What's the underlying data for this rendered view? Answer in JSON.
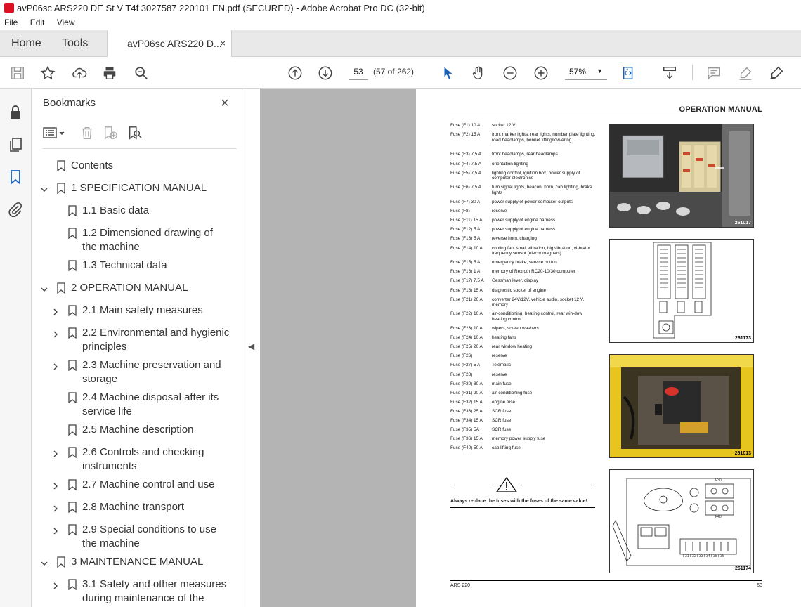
{
  "window": {
    "title": "avP06sc ARS220 DE St V T4f 3027587 220101 EN.pdf (SECURED) - Adobe Acrobat Pro DC (32-bit)"
  },
  "menu": [
    "File",
    "Edit",
    "View"
  ],
  "tabs": {
    "home": "Home",
    "tools": "Tools",
    "doc": "avP06sc ARS220 D...",
    "close": "×"
  },
  "toolbar": {
    "page_number": "53",
    "page_count": "(57 of 262)",
    "zoom": "57%"
  },
  "bookmarks": {
    "title": "Bookmarks",
    "close": "×",
    "items": [
      {
        "label": "Contents",
        "level": 0,
        "expand": "none"
      },
      {
        "label": "1 SPECIFICATION MANUAL",
        "level": 0,
        "expand": "open"
      },
      {
        "label": "1.1 Basic data",
        "level": 1,
        "expand": "none"
      },
      {
        "label": "1.2 Dimensioned drawing of",
        "label2": "the machine",
        "level": 1,
        "expand": "none"
      },
      {
        "label": "1.3 Technical data",
        "level": 1,
        "expand": "none"
      },
      {
        "label": "2 OPERATION MANUAL",
        "level": 0,
        "expand": "open"
      },
      {
        "label": "2.1 Main safety measures",
        "level": 1,
        "expand": "closed"
      },
      {
        "label": "2.2 Environmental and hygienic",
        "label2": "principles",
        "level": 1,
        "expand": "closed"
      },
      {
        "label": "2.3 Machine preservation and",
        "label2": "storage",
        "level": 1,
        "expand": "closed"
      },
      {
        "label": "2.4 Machine disposal after its",
        "label2": "service life",
        "level": 1,
        "expand": "none"
      },
      {
        "label": "2.5 Machine description",
        "level": 1,
        "expand": "none"
      },
      {
        "label": "2.6 Controls and checking",
        "label2": "instruments",
        "level": 1,
        "expand": "closed"
      },
      {
        "label": "2.7 Machine control and use",
        "level": 1,
        "expand": "closed"
      },
      {
        "label": "2.8 Machine transport",
        "level": 1,
        "expand": "closed"
      },
      {
        "label": "2.9 Special conditions to use",
        "label2": "the machine",
        "level": 1,
        "expand": "closed"
      },
      {
        "label": "3 MAINTENANCE MANUAL",
        "level": 0,
        "expand": "open"
      },
      {
        "label": "3.1 Safety and other measures",
        "label2": "during maintenance of the",
        "level": 1,
        "expand": "closed"
      }
    ]
  },
  "page": {
    "header": "OPERATION MANUAL",
    "fuses": [
      {
        "k": "Fuse (F1) 10 A",
        "v": "socket 12 V",
        "lines": 1
      },
      {
        "k": "Fuse (F2) 15 A",
        "v": "front marker lights, rear lights, number plate lighting, road headlamps, bonnet lifting/low-ering",
        "lines": 3
      },
      {
        "k": "Fuse (F3) 7,5 A",
        "v": "front headlamps, rear headlamps",
        "lines": 1
      },
      {
        "k": "Fuse (F4) 7,5 A",
        "v": "orientation lighting",
        "lines": 1
      },
      {
        "k": "Fuse (F5) 7,5 A",
        "v": "lighting control, ignition box, power supply of computer electronics",
        "lines": 2
      },
      {
        "k": "Fuse (F6) 7,5 A",
        "v": "turn signal lights, beacon, horn, cab lighting, brake lights",
        "lines": 2
      },
      {
        "k": "Fuse (F7) 30 A",
        "v": "power supply of power computer outputs",
        "lines": 1
      },
      {
        "k": "Fuse (F8)",
        "v": "reserve",
        "lines": 1
      },
      {
        "k": "Fuse (F11) 15 A",
        "v": "power supply of engine harness",
        "lines": 1
      },
      {
        "k": "Fuse (F12) 5 A",
        "v": "power supply of engine harness",
        "lines": 1
      },
      {
        "k": "Fuse (F13) 5 A",
        "v": "reverse horn, charging",
        "lines": 1
      },
      {
        "k": "Fuse (F14) 10 A",
        "v": "cooling fan, small vibration, big vibration, vi-brator frequency sensor (electromagnets)",
        "lines": 2
      },
      {
        "k": "Fuse (F15) 5 A",
        "v": "emergency brake, service button",
        "lines": 1
      },
      {
        "k": "Fuse (F16) 1 A",
        "v": "memory of Rexroth RC20-10/30 computer",
        "lines": 1
      },
      {
        "k": "Fuse (F17) 7,5 A",
        "v": "Gessman lever, display",
        "lines": 1
      },
      {
        "k": "Fuse (F18) 15 A",
        "v": "diagnostic socket of engine",
        "lines": 1
      },
      {
        "k": "Fuse (F21) 20 A",
        "v": "converter 24V/12V, vehicle audio, socket 12 V, memory",
        "lines": 2
      },
      {
        "k": "Fuse (F22) 10 A",
        "v": "air-conditioning, heating control, rear win-dow heating control",
        "lines": 2
      },
      {
        "k": "Fuse (F23) 10 A",
        "v": "wipers, screen washers",
        "lines": 1
      },
      {
        "k": "Fuse (F24) 10 A",
        "v": "heating fans",
        "lines": 1
      },
      {
        "k": "Fuse (F25) 20 A",
        "v": "rear window heating",
        "lines": 1
      },
      {
        "k": "Fuse (F26)",
        "v": "reserve",
        "lines": 1
      },
      {
        "k": "Fuse (F27) 5 A",
        "v": "Telematic",
        "lines": 1
      },
      {
        "k": "Fuse (F28)",
        "v": "reserve",
        "lines": 1
      },
      {
        "k": "Fuse (F30) 80 A",
        "v": "main fuse",
        "lines": 1
      },
      {
        "k": "Fuse (F31) 20 A",
        "v": "air-conditioning fuse",
        "lines": 1
      },
      {
        "k": "Fuse (F32) 15 A",
        "v": "engine fuse",
        "lines": 1
      },
      {
        "k": "Fuse (F33) 25 A",
        "v": "SCR fuse",
        "lines": 1
      },
      {
        "k": "Fuse (F34) 15 A",
        "v": "SCR fuse",
        "lines": 1
      },
      {
        "k": "Fuse (F35) 5A",
        "v": "SCR fuse",
        "lines": 1
      },
      {
        "k": "Fuse (F36) 15 A",
        "v": "memory power supply fuse",
        "lines": 1
      },
      {
        "k": "Fuse (F40) 50 A",
        "v": "cab lifting fuse",
        "lines": 1
      }
    ],
    "figures": [
      "261017",
      "261173",
      "261013",
      "261174"
    ],
    "fig4_labels": {
      "f30": "F30",
      "f40": "F40",
      "bottom": "F31 F32 F33 F34 F35 F36"
    },
    "warning": "Always replace the fuses with the fuses of the same value!",
    "footer_left": "ARS 220",
    "footer_right": "53"
  }
}
